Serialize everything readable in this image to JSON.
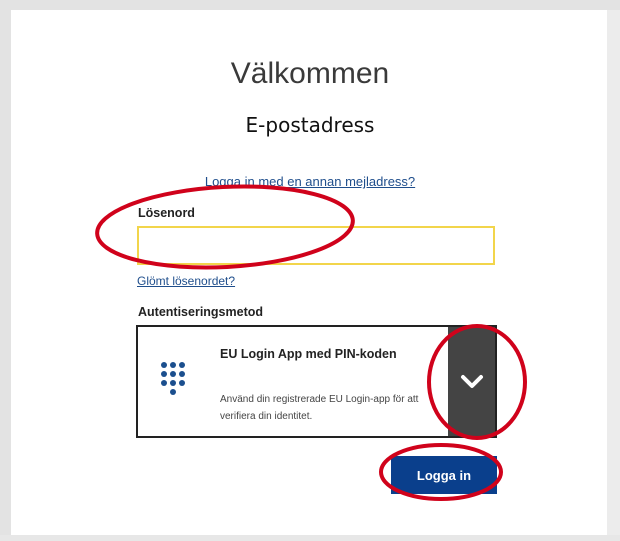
{
  "header": {
    "title": "Välkommen",
    "subtitle": "E-postadress"
  },
  "form": {
    "other_email_link": "Logga in med en annan mejladress?",
    "password_label": "Lösenord",
    "password_value": "",
    "forgot_link": "Glömt lösenordet?",
    "auth_method_label": "Autentiseringsmetod",
    "auth_method": {
      "title": "EU Login App med PIN-koden",
      "description": "Använd din registrerade EU Login-app för att verifiera din identitet.",
      "icon": "keypad-icon"
    },
    "login_button": "Logga in"
  },
  "colors": {
    "annotation": "#d0021b",
    "primary_button": "#0a3f8c",
    "input_border": "#f2d54b",
    "dropdown_bg": "#444444",
    "link": "#1f4e8c"
  }
}
